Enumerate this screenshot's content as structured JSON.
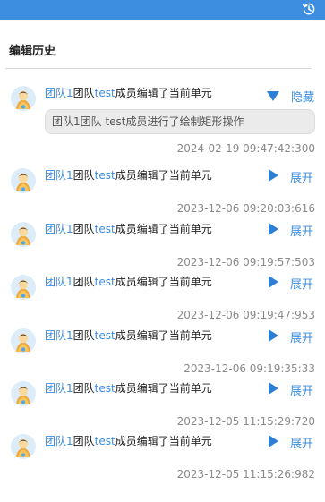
{
  "header": {
    "history_icon": "history-icon"
  },
  "panel": {
    "title": "编辑历史"
  },
  "entries": [
    {
      "team": "团队1",
      "mid": "团队",
      "user": "test",
      "action": "成员编辑了当前单元",
      "toggle": "隐藏",
      "expanded": true,
      "detail": "团队1团队 test成员进行了绘制矩形操作",
      "time": "2024-02-19 09:47:42:300"
    },
    {
      "team": "团队1",
      "mid": "团队",
      "user": "test",
      "action": "成员编辑了当前单元",
      "toggle": "展开",
      "expanded": false,
      "time": "2023-12-06 09:20:03:616"
    },
    {
      "team": "团队1",
      "mid": "团队",
      "user": "test",
      "action": "成员编辑了当前单元",
      "toggle": "展开",
      "expanded": false,
      "time": "2023-12-06 09:19:57:503"
    },
    {
      "team": "团队1",
      "mid": "团队",
      "user": "test",
      "action": "成员编辑了当前单元",
      "toggle": "展开",
      "expanded": false,
      "time": "2023-12-06 09:19:47:953"
    },
    {
      "team": "团队1",
      "mid": "团队",
      "user": "test",
      "action": "成员编辑了当前单元",
      "toggle": "展开",
      "expanded": false,
      "time": "2023-12-06 09:19:35:33"
    },
    {
      "team": "团队1",
      "mid": "团队",
      "user": "test",
      "action": "成员编辑了当前单元",
      "toggle": "展开",
      "expanded": false,
      "time": "2023-12-05 11:15:29:720"
    },
    {
      "team": "团队1",
      "mid": "团队",
      "user": "test",
      "action": "成员编辑了当前单元",
      "toggle": "展开",
      "expanded": false,
      "time": "2023-12-05 11:15:26:982"
    }
  ]
}
